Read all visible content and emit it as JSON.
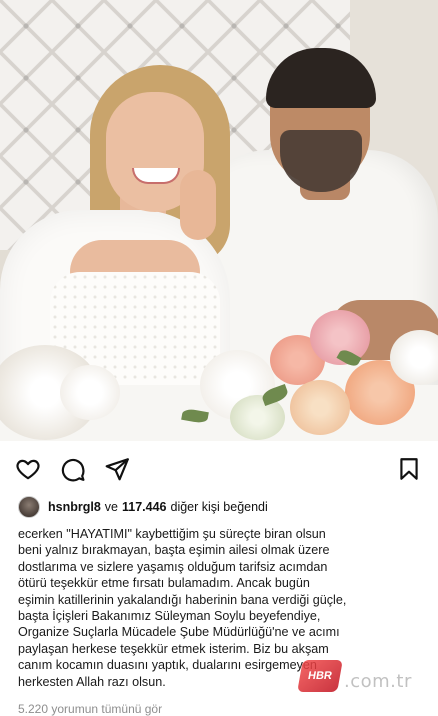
{
  "actions": {
    "like_icon": "heart-outline-icon",
    "comment_icon": "comment-bubble-icon",
    "share_icon": "paper-plane-icon",
    "save_icon": "bookmark-outline-icon"
  },
  "likes": {
    "username": "hsnbrgl8",
    "connector": "ve",
    "count": "117.446",
    "suffix": "diğer kişi beğendi"
  },
  "caption": {
    "lines": [
      "ecerken \"HAYATIMI\" kaybettiğim şu süreçte biran olsun",
      "beni yalnız bırakmayan, başta eşimin ailesi olmak üzere",
      "dostlarıma ve sizlere yaşamış olduğum tarifsiz acımdan",
      "ötürü teşekkür etme fırsatı bulamadım. Ancak bugün",
      "eşimin katillerinin yakalandığı haberinin bana verdiği güçle,",
      "başta İçişleri Bakanımız Süleyman Soylu beyefendiye,",
      "Organize Suçlarla Mücadele Şube Müdürlüğü'ne ve acımı",
      "paylaşan herkese teşekkür etmek isterim. Biz bu akşam",
      "canım kocamın duasını yaptık, dualarını esirgemeyen",
      "herkesten Allah razı olsun."
    ]
  },
  "footer": {
    "text": "5.220 yorumun tümünü gör"
  },
  "watermark": {
    "logo": "HBR",
    "domain": ".com.tr"
  }
}
